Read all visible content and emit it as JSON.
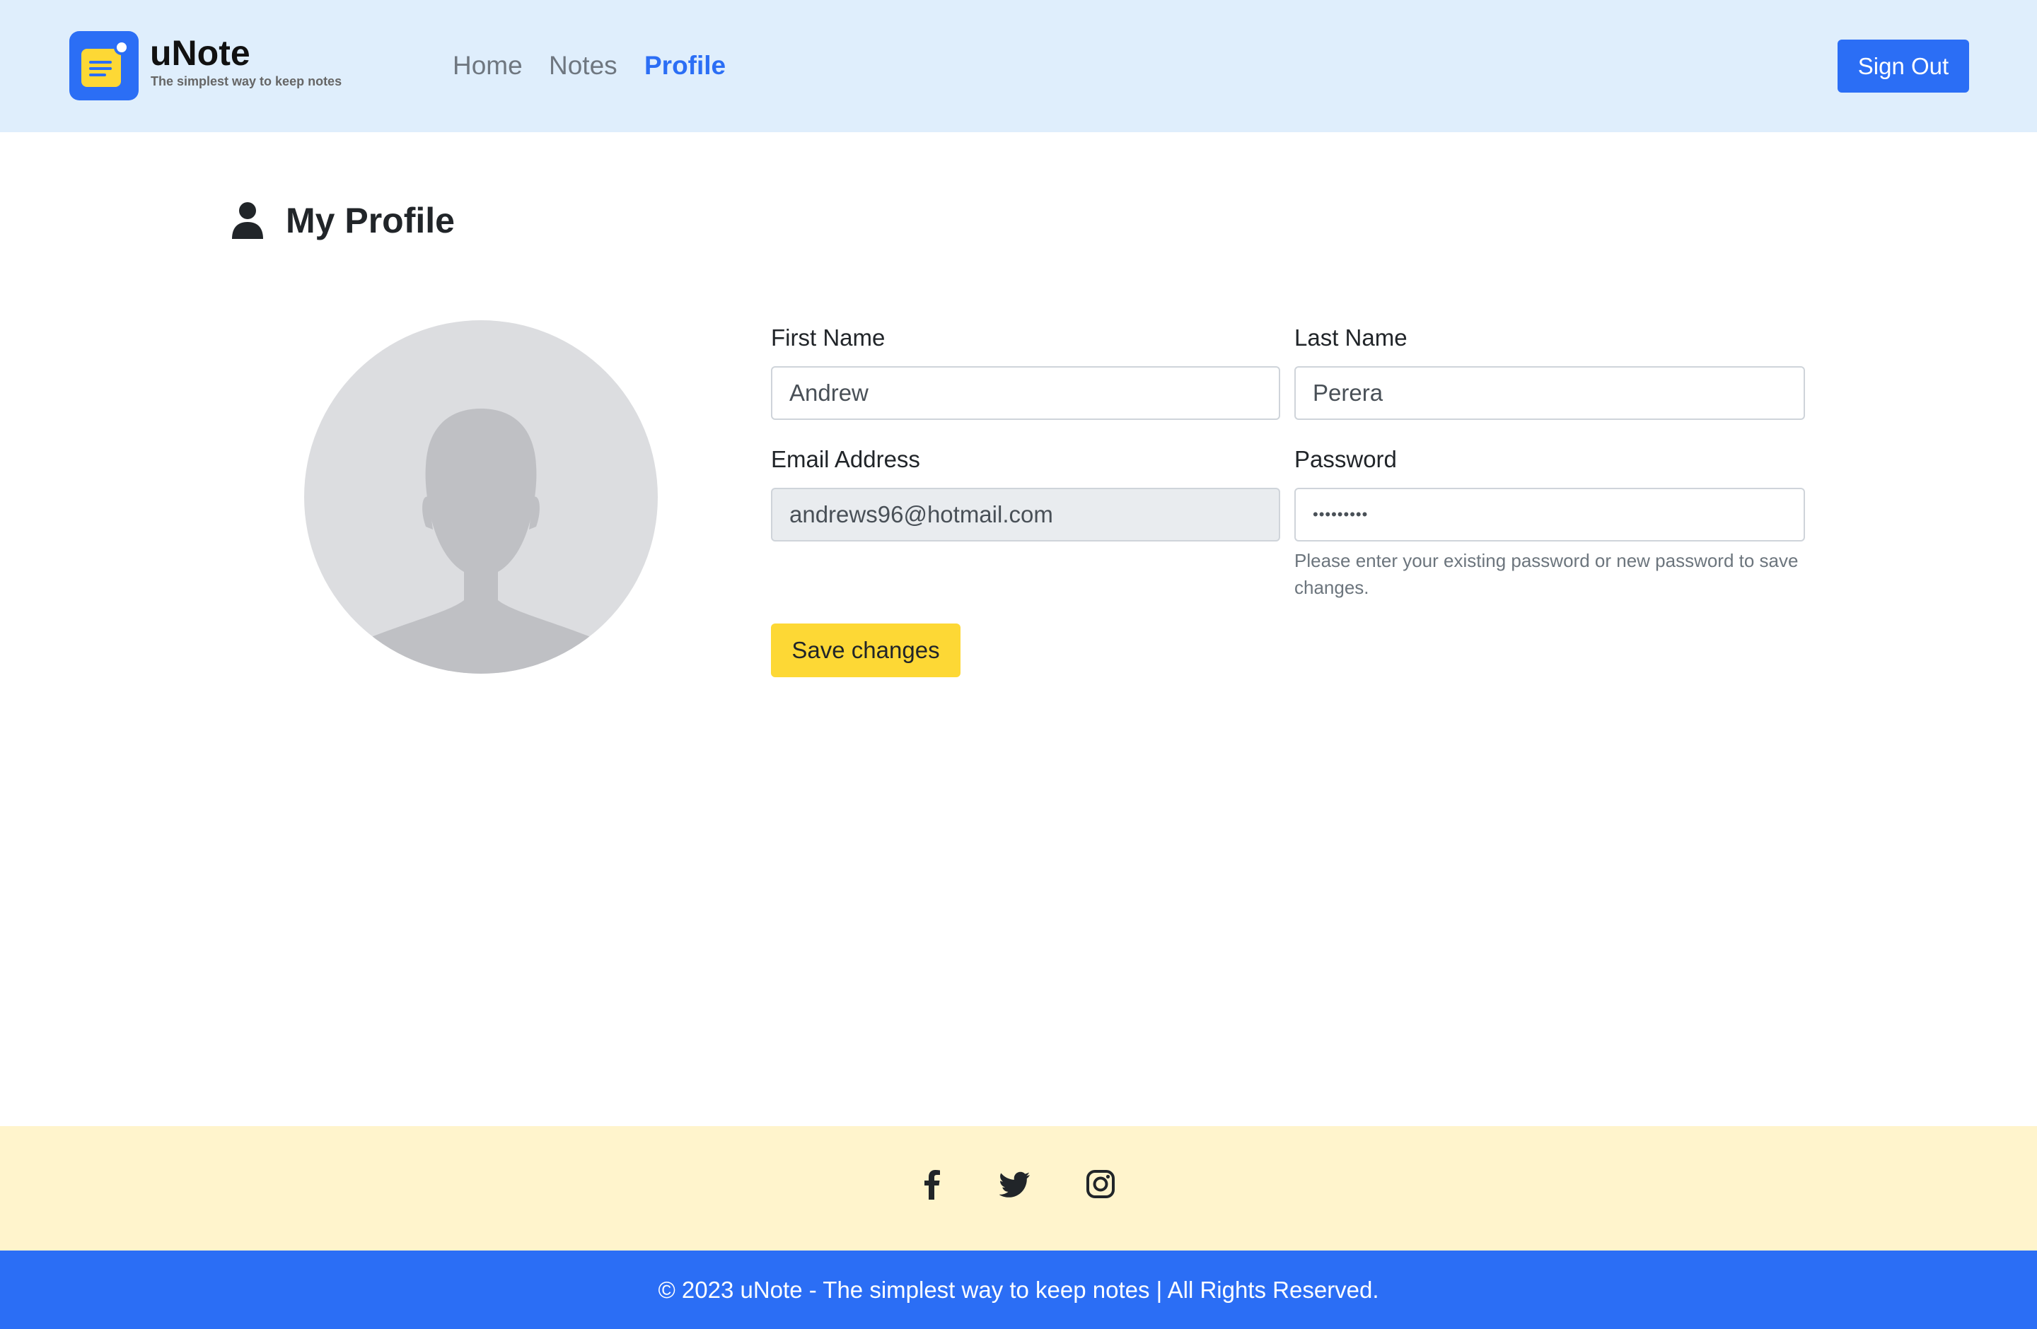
{
  "header": {
    "brand_name": "uNote",
    "brand_tagline": "The simplest way to keep notes",
    "nav": [
      {
        "label": "Home",
        "active": false
      },
      {
        "label": "Notes",
        "active": false
      },
      {
        "label": "Profile",
        "active": true
      }
    ],
    "sign_out_label": "Sign Out"
  },
  "main": {
    "title": "My Profile",
    "title_icon": "person-icon",
    "avatar_icon": "default-avatar-silhouette"
  },
  "form": {
    "first_name": {
      "label": "First Name",
      "value": "Andrew"
    },
    "last_name": {
      "label": "Last Name",
      "value": "Perera"
    },
    "email": {
      "label": "Email Address",
      "value": "andrews96@hotmail.com",
      "disabled": true
    },
    "password": {
      "label": "Password",
      "value": "•••••••••"
    },
    "password_help": "Please enter your existing password or new password to save changes.",
    "save_label": "Save changes"
  },
  "footer": {
    "social_icons": [
      "facebook-icon",
      "twitter-icon",
      "instagram-icon"
    ],
    "copyright": "© 2023 uNote - The simplest way to keep notes | All Rights Reserved."
  },
  "colors": {
    "primary": "#2b6ef5",
    "accent_yellow": "#fdd835",
    "header_bg": "#dfeefc",
    "social_bar_bg": "#fff4cc"
  }
}
